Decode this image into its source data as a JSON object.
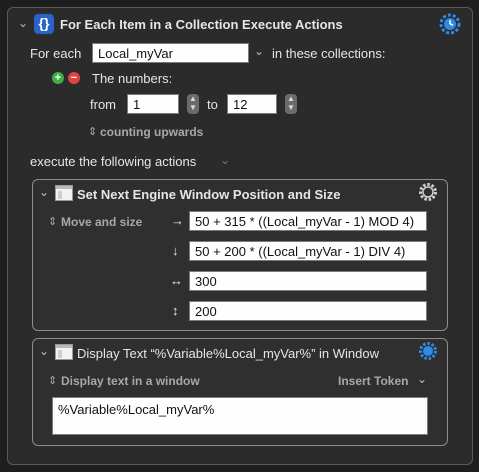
{
  "header": {
    "title": "For Each Item in a Collection Execute Actions",
    "icon": "curly-braces-icon"
  },
  "for_each": {
    "label": "For each",
    "variable_value": "Local_myVar",
    "suffix": "in these collections:"
  },
  "collection": {
    "title": "The numbers:",
    "from_label": "from",
    "from_value": "1",
    "to_label": "to",
    "to_value": "12",
    "direction": "counting upwards"
  },
  "execute_label": "execute the following actions",
  "action1": {
    "title": "Set Next Engine Window Position and Size",
    "mode": "Move and size",
    "rows": [
      {
        "symbol": "→",
        "value": "50 + 315 * ((Local_myVar - 1) MOD 4)"
      },
      {
        "symbol": "↓",
        "value": "50 + 200 * ((Local_myVar - 1) DIV 4)"
      },
      {
        "symbol": "↔",
        "value": "300"
      },
      {
        "symbol": "↕",
        "value": "200"
      }
    ]
  },
  "action2": {
    "title": "Display Text “%Variable%Local_myVar%” in Window",
    "mode": "Display text in a window",
    "insert_token": "Insert Token",
    "text_value": "%Variable%Local_myVar%"
  },
  "colors": {
    "accent_gear": "#2e8ce6",
    "plus": "#3cb043",
    "minus": "#e0443e"
  }
}
